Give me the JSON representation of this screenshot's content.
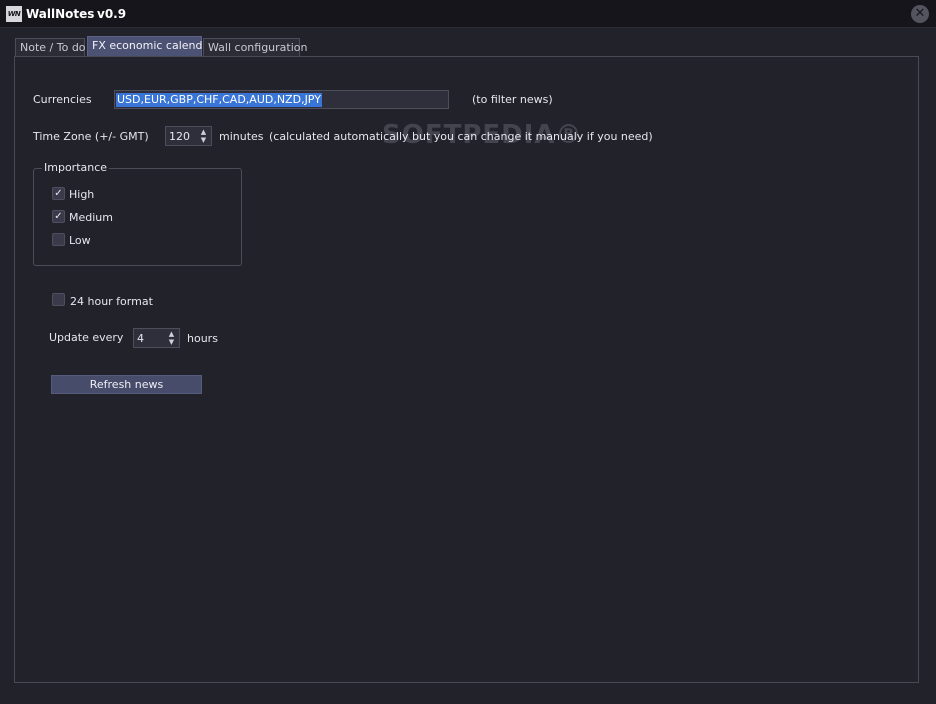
{
  "titlebar": {
    "logo_text": "WN",
    "app_name": "WallNotes",
    "version": "v0.9",
    "close_glyph": "✕"
  },
  "tabs": [
    {
      "label": "Note / To do"
    },
    {
      "label": "FX economic calendar",
      "active": true
    },
    {
      "label": "Wall configuration"
    }
  ],
  "currencies": {
    "label": "Currencies",
    "value": "USD,EUR,GBP,CHF,CAD,AUD,NZD,JPY",
    "hint": "(to filter news)"
  },
  "timezone": {
    "label": "Time Zone (+/- GMT)",
    "value": "120",
    "unit": "minutes",
    "note": "(calculated automatically but you can change it manualy  if you need)"
  },
  "importance": {
    "title": "Importance",
    "options": [
      {
        "label": "High",
        "checked": true
      },
      {
        "label": "Medium",
        "checked": true
      },
      {
        "label": "Low",
        "checked": false
      }
    ]
  },
  "format24": {
    "label": "24 hour format",
    "checked": false
  },
  "update": {
    "label": "Update every",
    "value": "4",
    "unit": "hours"
  },
  "refresh_button": "Refresh news",
  "watermark": "SOFTPEDIA®",
  "colors": {
    "background": "#22222b",
    "titlebar": "#15151b",
    "accent": "#4c5273",
    "selection": "#3875d6"
  },
  "icons": {
    "check": "✓",
    "spin_up": "▲",
    "spin_down": "▼"
  }
}
